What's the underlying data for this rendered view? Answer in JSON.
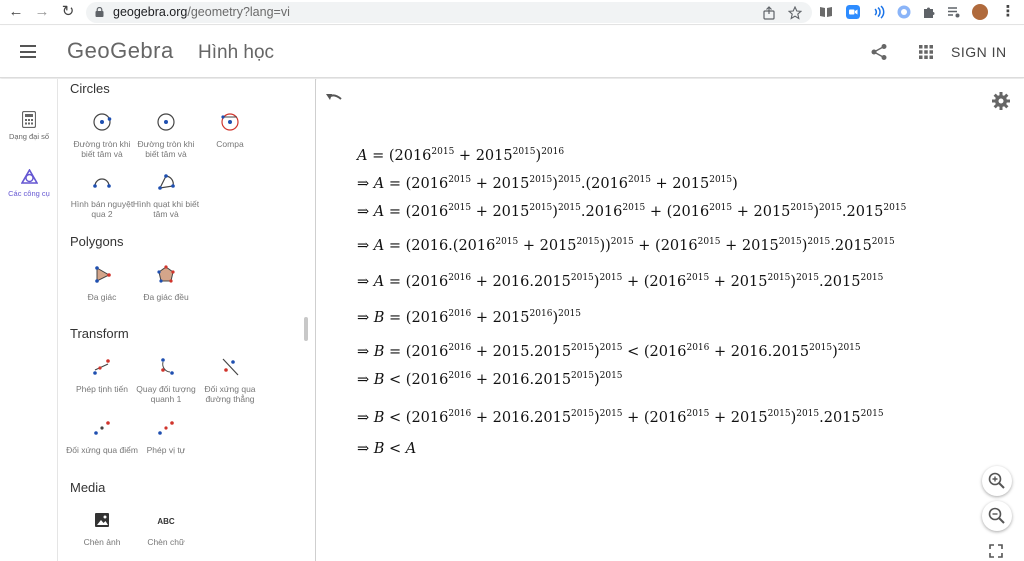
{
  "browser": {
    "url_host": "geogebra.org",
    "url_path": "/geometry?lang=vi"
  },
  "header": {
    "logo": "GeoGebra",
    "title": "Hình học",
    "signin": "SIGN IN"
  },
  "rail": {
    "items": [
      {
        "label": "Dạng đại số",
        "icon": "calculator-icon"
      },
      {
        "label": "Các công cụ",
        "icon": "tools-icon"
      }
    ]
  },
  "tools": {
    "categories": {
      "circles": "Circles",
      "polygons": "Polygons",
      "transform": "Transform",
      "media": "Media"
    },
    "circles": [
      {
        "label": "Đường tròn khi biết tâm và",
        "icon": "circle-center-point-icon"
      },
      {
        "label": "Đường tròn khi biết tâm và",
        "icon": "circle-center-radius-icon"
      },
      {
        "label": "Compa",
        "icon": "compass-icon"
      },
      {
        "label": "Hình bán nguyệt qua 2",
        "icon": "semicircle-icon"
      },
      {
        "label": "Hình quạt khi biết tâm và",
        "icon": "circular-sector-icon"
      }
    ],
    "polygons": [
      {
        "label": "Đa giác",
        "icon": "polygon-icon"
      },
      {
        "label": "Đa giác đều",
        "icon": "regular-polygon-icon"
      }
    ],
    "transform": [
      {
        "label": "Phép tịnh tiến",
        "icon": "translate-icon"
      },
      {
        "label": "Quay đối tượng quanh 1",
        "icon": "rotate-around-point-icon"
      },
      {
        "label": "Đối xứng qua đường thẳng",
        "icon": "reflect-line-icon"
      },
      {
        "label": "Đối xứng qua điểm",
        "icon": "reflect-point-icon"
      },
      {
        "label": "Phép vị tự",
        "icon": "dilate-icon"
      }
    ],
    "media": [
      {
        "label": "Chèn ảnh",
        "icon": "image-icon"
      },
      {
        "label": "Chèn chữ",
        "icon": "text-icon"
      }
    ]
  },
  "colors": {
    "accent": "#6557d2",
    "point_blue": "#1f4fb0",
    "point_red": "#d0342c",
    "polygon_fill": "#d4a58a"
  }
}
